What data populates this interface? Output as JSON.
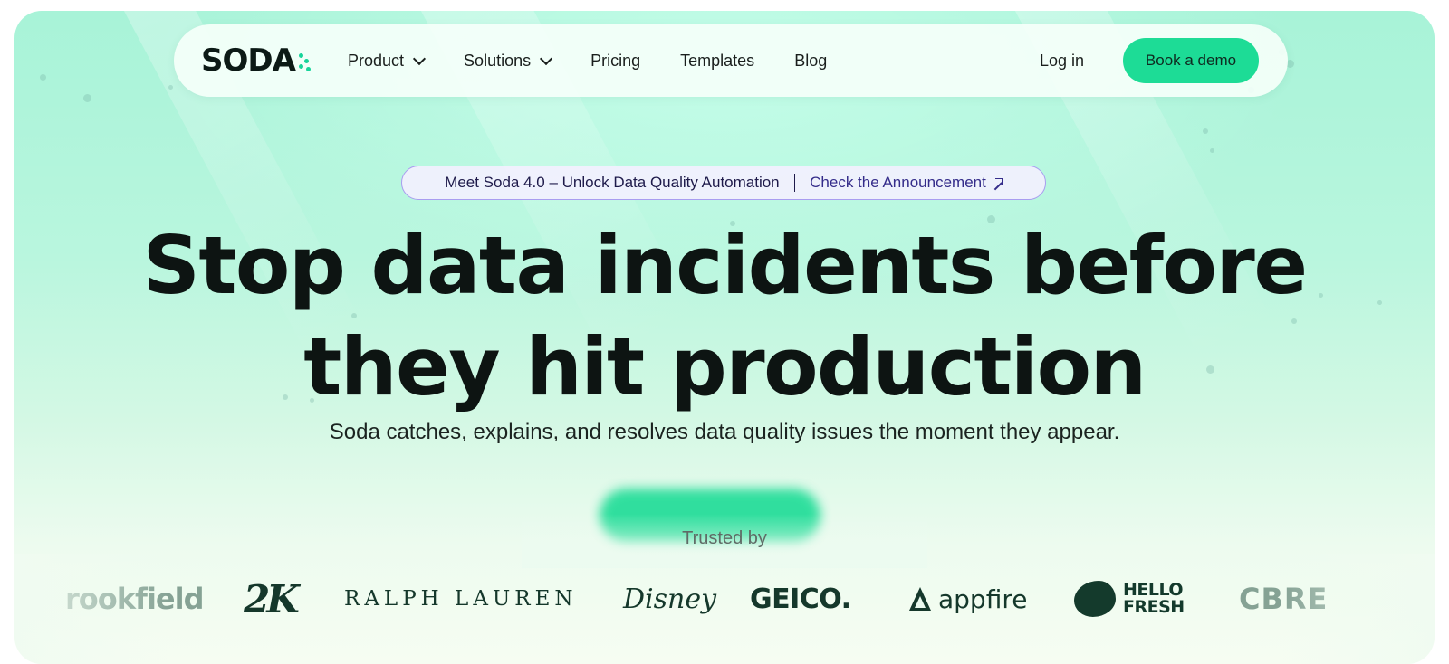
{
  "nav": {
    "logo": "SODA",
    "items": [
      {
        "label": "Product",
        "dropdown": true
      },
      {
        "label": "Solutions",
        "dropdown": true
      },
      {
        "label": "Pricing",
        "dropdown": false
      },
      {
        "label": "Templates",
        "dropdown": false
      },
      {
        "label": "Blog",
        "dropdown": false
      }
    ],
    "login_label": "Log in",
    "demo_label": "Book a demo"
  },
  "announcement": {
    "text": "Meet Soda 4.0 – Unlock Data Quality Automation",
    "separator": "|",
    "link_label": "Check the Announcement"
  },
  "hero": {
    "headline_line1": "Stop data incidents before",
    "headline_line2": "they hit production",
    "subheadline": "Soda catches, explains, and resolves data quality issues the moment they appear."
  },
  "trusted": {
    "label": "Trusted by",
    "brands": {
      "brookfield": "rookfield",
      "twok": "2K",
      "ralph_lauren": "RALPH LAUREN",
      "disney": "Disney",
      "geico": "GEICO.",
      "appfire": "appfire",
      "hellofresh_line1": "HELLO",
      "hellofresh_line2": "FRESH",
      "cbre": "CBRE"
    }
  },
  "colors": {
    "accent": "#1ddc96",
    "announcement_border": "#a99df0",
    "brand_dark": "#15382b"
  }
}
